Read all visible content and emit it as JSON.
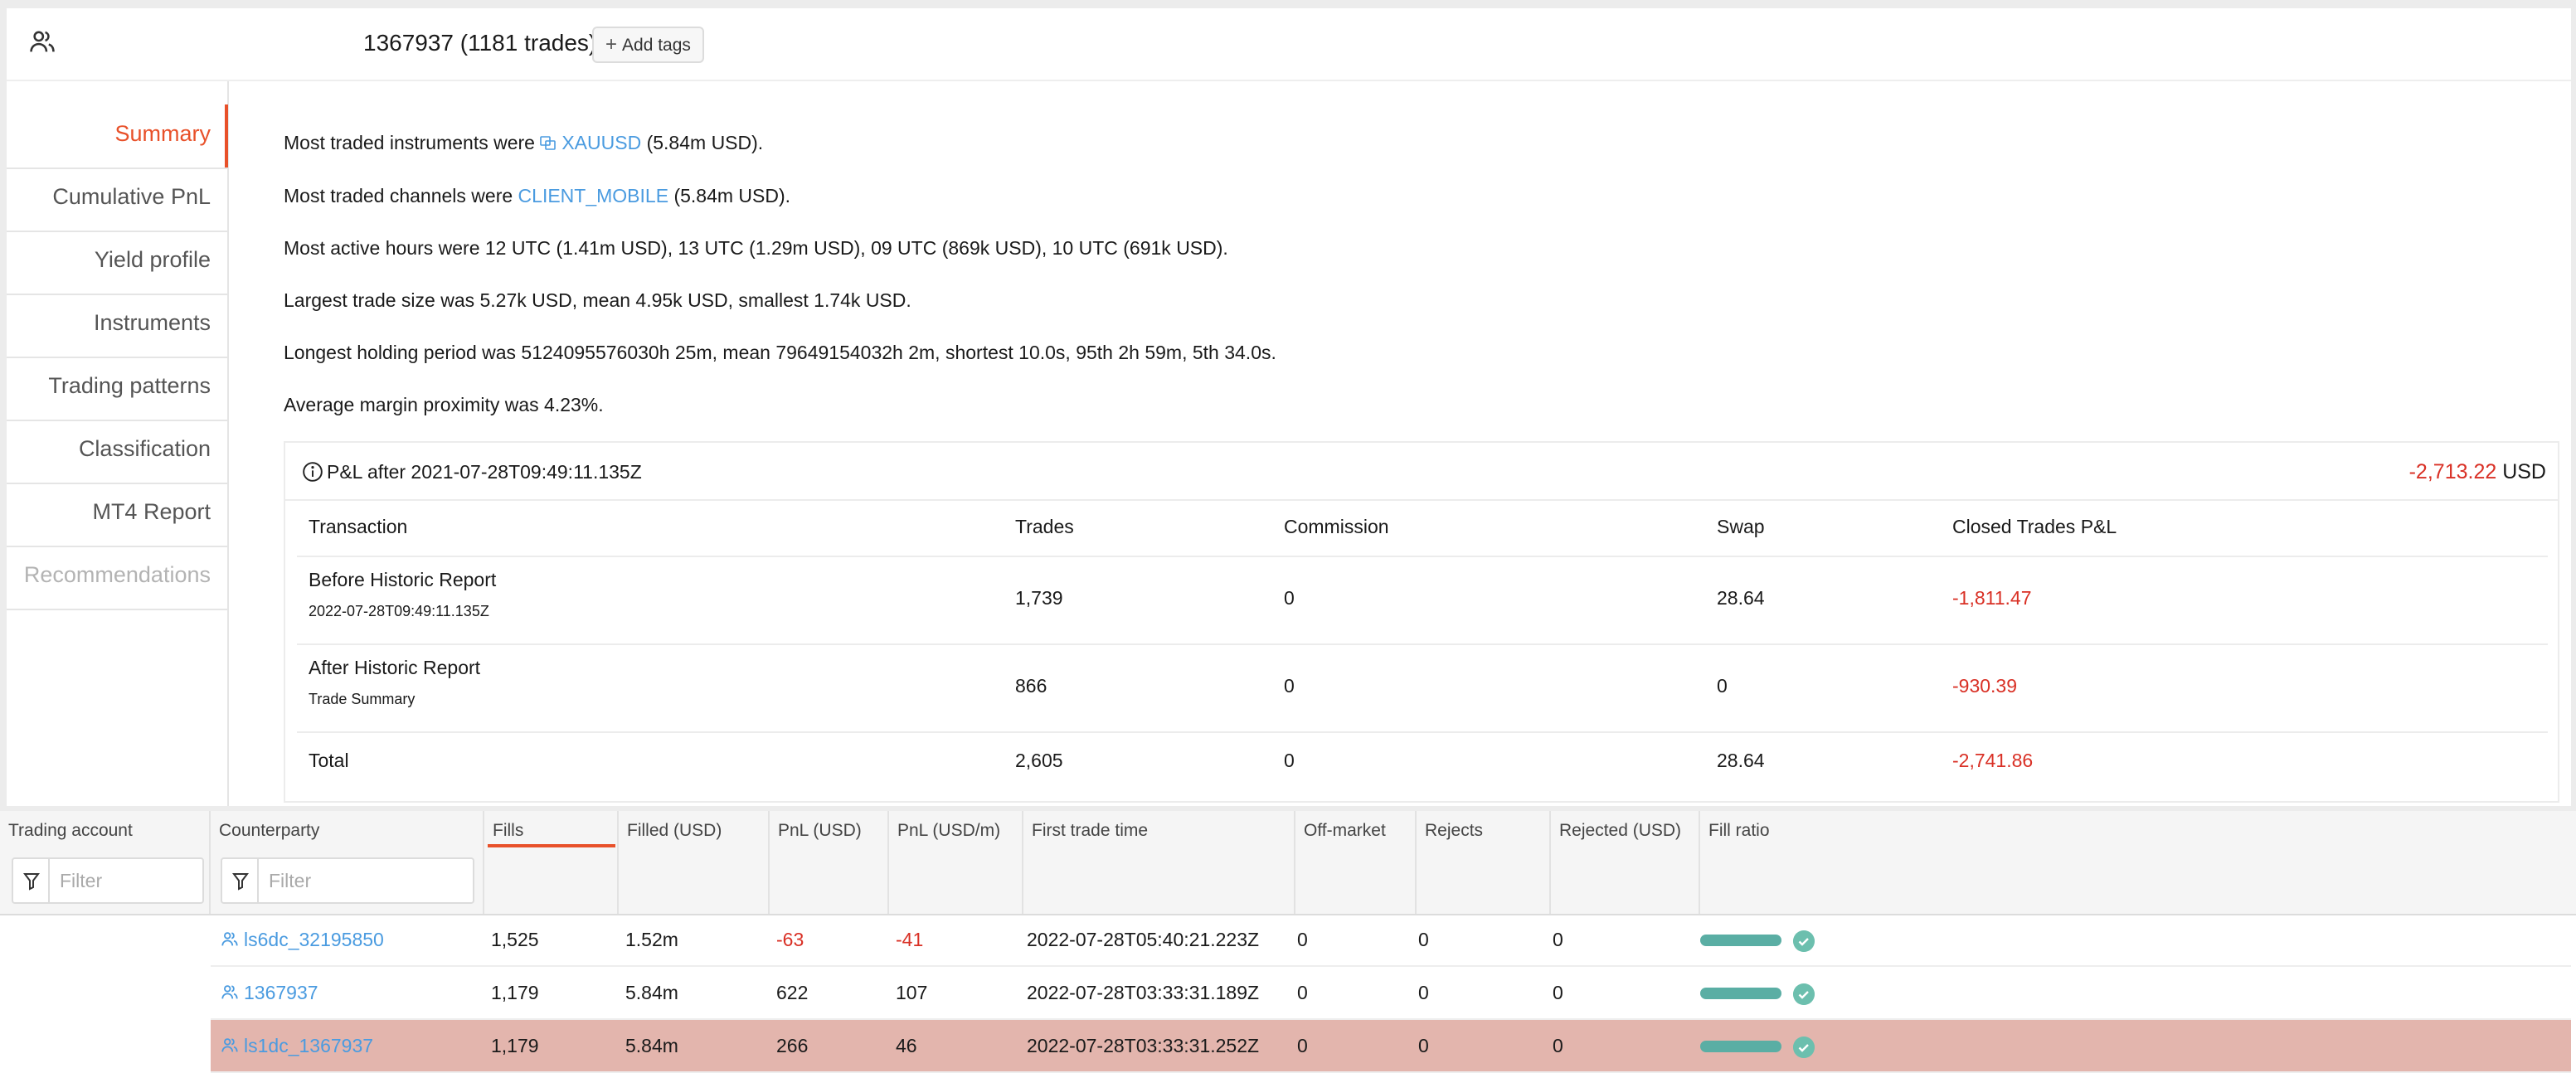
{
  "header": {
    "account_title": "1367937 (1181 trades)",
    "add_tags_label": "Add tags"
  },
  "sidebar": {
    "items": [
      {
        "label": "Summary"
      },
      {
        "label": "Cumulative PnL"
      },
      {
        "label": "Yield profile"
      },
      {
        "label": "Instruments"
      },
      {
        "label": "Trading patterns"
      },
      {
        "label": "Classification"
      },
      {
        "label": "MT4 Report"
      },
      {
        "label": "Recommendations"
      }
    ]
  },
  "summary": {
    "instruments_prefix": "Most traded instruments were",
    "instruments_link": "XAUUSD",
    "instruments_suffix": "(5.84m USD).",
    "channels_prefix": "Most traded channels were",
    "channels_link": "CLIENT_MOBILE",
    "channels_suffix": "(5.84m USD).",
    "active_hours": "Most active hours were 12 UTC (1.41m USD), 13 UTC (1.29m USD), 09 UTC (869k USD), 10 UTC (691k USD).",
    "trade_size": "Largest trade size was 5.27k USD, mean 4.95k USD, smallest 1.74k USD.",
    "holding": "Longest holding period was 5124095576030h 25m, mean 79649154032h 2m, shortest 10.0s, 95th 2h 59m, 5th 34.0s.",
    "margin": "Average margin proximity was 4.23%."
  },
  "pnl_report": {
    "title": "P&L after 2021-07-28T09:49:11.135Z",
    "total_value": "-2,713.22",
    "total_unit": "USD",
    "columns": [
      "Transaction",
      "Trades",
      "Commission",
      "Swap",
      "Closed Trades P&L"
    ],
    "rows": [
      {
        "name": "Before Historic Report",
        "sub": "2022-07-28T09:49:11.135Z",
        "trades": "1,739",
        "commission": "0",
        "swap": "28.64",
        "pnl": "-1,811.47"
      },
      {
        "name": "After Historic Report",
        "sub": "Trade Summary",
        "trades": "866",
        "commission": "0",
        "swap": "0",
        "pnl": "-930.39"
      },
      {
        "name": "Total",
        "sub": "",
        "trades": "2,605",
        "commission": "0",
        "swap": "28.64",
        "pnl": "-2,741.86"
      }
    ]
  },
  "grid": {
    "columns": [
      "Trading account",
      "Counterparty",
      "Fills",
      "Filled (USD)",
      "PnL (USD)",
      "PnL (USD/m)",
      "First trade time",
      "Off-market",
      "Rejects",
      "Rejected (USD)",
      "Fill ratio"
    ],
    "filter_placeholder": "Filter",
    "sorted_column": "Fills",
    "rows": [
      {
        "counterparty": "ls6dc_32195850",
        "fills": "1,525",
        "filled": "1.52m",
        "pnl": "-63",
        "pnl_m": "-41",
        "first_trade": "2022-07-28T05:40:21.223Z",
        "off_market": "0",
        "rejects": "0",
        "rejected": "0",
        "fill_ratio": 1.0
      },
      {
        "counterparty": "1367937",
        "fills": "1,179",
        "filled": "5.84m",
        "pnl": "622",
        "pnl_m": "107",
        "first_trade": "2022-07-28T03:33:31.189Z",
        "off_market": "0",
        "rejects": "0",
        "rejected": "0",
        "fill_ratio": 1.0
      },
      {
        "counterparty": "ls1dc_1367937",
        "fills": "1,179",
        "filled": "5.84m",
        "pnl": "266",
        "pnl_m": "46",
        "first_trade": "2022-07-28T03:33:31.252Z",
        "off_market": "0",
        "rejects": "0",
        "rejected": "0",
        "fill_ratio": 1.0
      }
    ]
  },
  "colors": {
    "accent": "#e8512a",
    "link": "#4a9be0",
    "negative": "#d93025",
    "fill_bar": "#5aaea4",
    "selected_row": "#e3b5ad"
  }
}
